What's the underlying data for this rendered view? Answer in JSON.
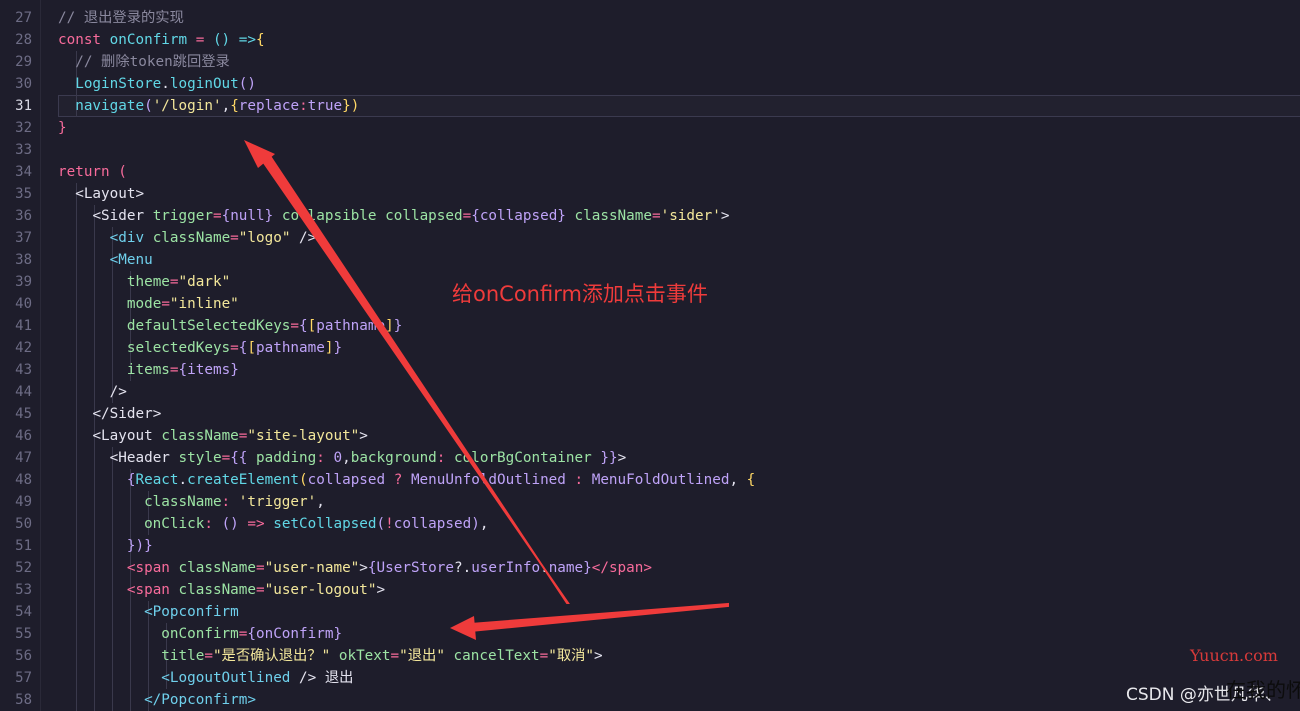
{
  "editor": {
    "gutter": [
      "27",
      "28",
      "29",
      "30",
      "31",
      "32",
      "33",
      "34",
      "35",
      "36",
      "37",
      "38",
      "39",
      "40",
      "41",
      "42",
      "43",
      "44",
      "45",
      "46",
      "47",
      "48",
      "49",
      "50",
      "51",
      "52",
      "53",
      "54",
      "55",
      "56",
      "57",
      "58"
    ],
    "active_line": "31"
  },
  "tokens": {
    "c27": "// 退出登录的实现",
    "k28a": "const",
    "f28": "onConfirm",
    "p28a": "=",
    "p28b": "() =>",
    "b28": "{",
    "c29": "// 删除token跳回登录",
    "v30": "LoginStore",
    "p30": ".",
    "f30": "loginOut",
    "b30": "()",
    "f31": "navigate",
    "b31a": "(",
    "s31": "'/login'",
    "p31a": ",",
    "b31b": "{",
    "v31a": "replace",
    "p31b": ":",
    "k31": "true",
    "b31c": "})",
    "b32": "}",
    "k34": "return",
    "b34": "(",
    "t35": "<Layout>",
    "t36a": "<Sider",
    "a36a": "trigger",
    "p36a": "=",
    "b36a": "{",
    "k36": "null",
    "b36b": "}",
    "a36b": "collapsible",
    "a36c": "collapsed",
    "p36b": "=",
    "b36c": "{",
    "v36": "collapsed",
    "b36d": "}",
    "a36d": "className",
    "p36c": "=",
    "s36": "'sider'",
    "t36b": ">",
    "t37a": "<div",
    "a37": "className",
    "p37": "=",
    "s37": "\"logo\"",
    "t37b": "/>",
    "t38": "<Menu",
    "a39": "theme",
    "p39": "=",
    "s39": "\"dark\"",
    "a40": "mode",
    "p40": "=",
    "s40": "\"inline\"",
    "a41": "defaultSelectedKeys",
    "p41": "=",
    "b41a": "{",
    "b41b": "[",
    "v41": "pathname",
    "b41c": "]",
    "b41d": "}",
    "a42": "selectedKeys",
    "p42": "=",
    "b42a": "{",
    "b42b": "[",
    "v42": "pathname",
    "b42c": "]",
    "b42d": "}",
    "a43": "items",
    "p43": "=",
    "b43a": "{",
    "v43": "items",
    "b43b": "}",
    "t44": "/>",
    "t45": "</Sider>",
    "t46a": "<Layout",
    "a46": "className",
    "p46": "=",
    "s46": "\"site-layout\"",
    "t46b": ">",
    "t47a": "<Header",
    "a47": "style",
    "p47a": "=",
    "b47a": "{{",
    "v47a": "padding",
    "p47b": ":",
    "k47": "0",
    "p47c": ",",
    "v47b": "background",
    "p47d": ":",
    "v47c": "colorBgContainer",
    "b47b": "}}",
    "t47b": ">",
    "b48a": "{",
    "v48a": "React",
    "p48a": ".",
    "f48": "createElement",
    "b48b": "(",
    "v48b": "collapsed",
    "k48a": "?",
    "v48c": "MenuUnfoldOutlined",
    "k48b": ":",
    "v48d": "MenuFoldOutlined",
    "p48b": ",",
    "b48c": "{",
    "v49": "className",
    "p49a": ":",
    "s49": "'trigger'",
    "p49b": ",",
    "f50a": "onClick",
    "p50a": ":",
    "b50a": "()",
    "p50b": "=>",
    "f50b": "setCollapsed",
    "b50b": "(",
    "k50": "!",
    "v50": "collapsed",
    "b50c": ")",
    "p50c": ",",
    "b51": "})}",
    "t52a": "<span",
    "a52": "className",
    "p52": "=",
    "s52": "\"user-name\"",
    "t52b": ">",
    "b52a": "{",
    "v52a": "UserStore",
    "p52b": "?.",
    "v52b": "userInfo",
    "p52c": ".",
    "v52c": "name",
    "b52b": "}",
    "t52c": "</span>",
    "t53a": "<span",
    "a53": "className",
    "p53": "=",
    "s53": "\"user-logout\"",
    "t53b": ">",
    "t54": "<Popconfirm",
    "a55": "onConfirm",
    "p55": "=",
    "b55a": "{",
    "v55": "onConfirm",
    "b55b": "}",
    "a56a": "title",
    "p56a": "=",
    "s56a": "\"是否确认退出？\"",
    "a56b": "okText",
    "p56b": "=",
    "s56b": "\"退出\"",
    "a56c": "cancelText",
    "p56c": "=",
    "s56c": "\"取消\"",
    "t56": ">",
    "t57a": "<LogoutOutlined",
    "t57b": "/>",
    "p57": "退出",
    "t58": "</Popconfirm>"
  },
  "annotation": "给onConfirm添加点击事件",
  "watermarks": {
    "site": "Yuucn.com",
    "csdn": "CSDN @亦世凡华、",
    "overlay": "在我的怀"
  },
  "colors": {
    "background": "#1e1d2b",
    "keyword": "#f86b9b",
    "annotation": "#ef3b3b",
    "arrow": "#ef3b3b"
  }
}
